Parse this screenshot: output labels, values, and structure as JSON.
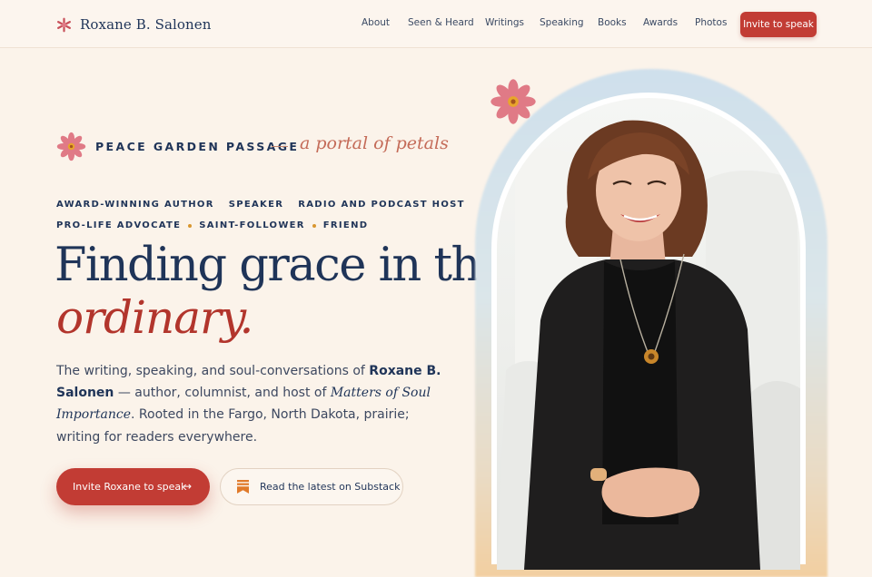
{
  "nav": {
    "brand": "Roxane B. Salonen",
    "links": [
      "About",
      "Seen & Heard",
      "Writings",
      "Speaking",
      "Books",
      "Awards",
      "Photos"
    ],
    "cta": "Invite to speak"
  },
  "hero": {
    "eyebrow_title": "PEACE GARDEN PASSAGE",
    "eyebrow_script": "a portal of petals",
    "roles_line1": [
      "AWARD-WINNING AUTHOR",
      "SPEAKER",
      "RADIO AND PODCAST HOST"
    ],
    "roles_line2": [
      "PRO-LIFE ADVOCATE",
      "SAINT-FOLLOWER",
      "FRIEND"
    ],
    "headline": "Finding grace in the",
    "headline_script": "ordinary.",
    "intro": {
      "part1": "The writing, speaking, and soul-conversations of ",
      "name": "Roxane B. Salonen",
      "part2": " — author, columnist, and host of ",
      "show": "Matters of Soul Importance",
      "part3": ". Rooted in the Fargo, North Dakota, prairie; writing for readers everywhere."
    },
    "primary_button": "Invite Roxane to speak",
    "primary_arrow": "→",
    "secondary_button": "Read the latest on Substack"
  },
  "colors": {
    "accent": "#c23c34",
    "navy": "#1f3458",
    "flower_petal": "#e07a86",
    "flower_center": "#e8a52c",
    "background": "#fbf3ea"
  },
  "icons": {
    "brand": "asterisk-flower-icon",
    "eyebrow": "flower-icon",
    "secondary_button": "bookmark-icon",
    "arrow": "arrow-right-icon"
  }
}
